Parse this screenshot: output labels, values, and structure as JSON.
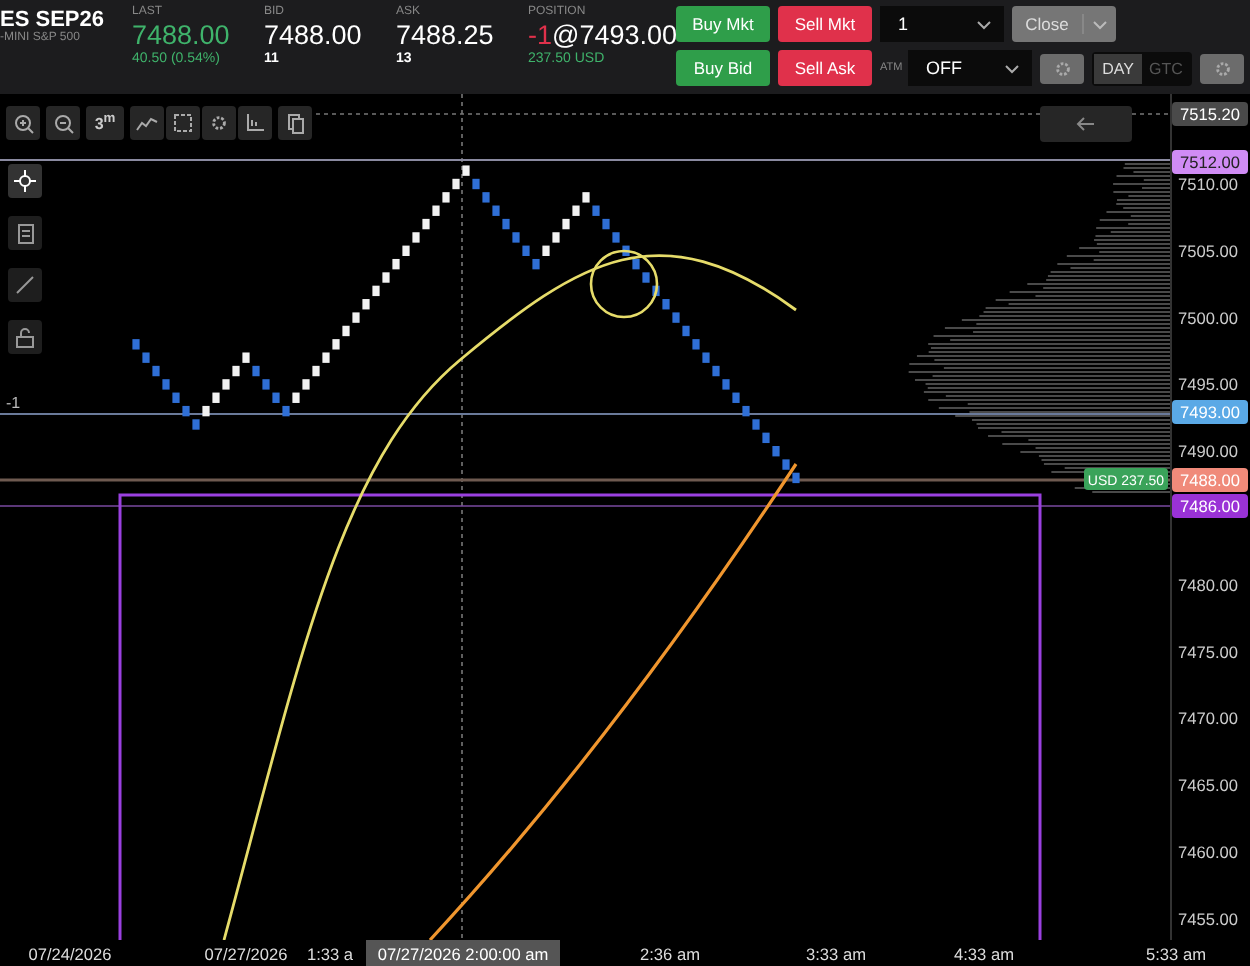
{
  "instrument": {
    "symbol": "ES SEP26",
    "name": "-MINI S&P 500"
  },
  "quotes": [
    {
      "label": "LAST",
      "value": "7488.00",
      "sub": "40.50 (0.54%)",
      "kind": "last"
    },
    {
      "label": "BID",
      "value": "7488.00",
      "sub": "11",
      "kind": "plain"
    },
    {
      "label": "ASK",
      "value": "7488.25",
      "sub": "13",
      "kind": "plain"
    }
  ],
  "position": {
    "label": "POSITION",
    "qty": "-1",
    "price": "@7493.00",
    "pnl": "237.50 USD"
  },
  "order_rows": [
    [
      {
        "kind": "buy",
        "label": "Buy Mkt"
      },
      {
        "kind": "sell",
        "label": "Sell Mkt"
      },
      {
        "kind": "select",
        "value": "1"
      },
      {
        "kind": "split",
        "label": "Close",
        "disabled": true
      }
    ],
    [
      {
        "kind": "buy",
        "label": "Buy Bid"
      },
      {
        "kind": "sell",
        "label": "Sell Ask"
      },
      {
        "kind": "label",
        "label": "ATM"
      },
      {
        "kind": "select",
        "value": "OFF"
      },
      {
        "kind": "gear"
      },
      {
        "kind": "toggle",
        "options": [
          {
            "label": "DAY",
            "selected": true
          },
          {
            "label": "GTC",
            "selected": false
          }
        ]
      },
      {
        "kind": "gear"
      }
    ]
  ],
  "toolbar": {
    "interval": "3$^{m}$"
  },
  "drawing_tools": [
    {
      "selected": true
    },
    {
      "selected": false
    },
    {
      "selected": false
    },
    {
      "selected": false
    }
  ],
  "chart": {
    "position_marker": "-1",
    "pnl_tag": "USD 237.50",
    "price_labels": [
      {
        "text": "7515.20",
        "kind": "crosshair"
      },
      {
        "text": "7512.00",
        "kind": "alert"
      },
      {
        "text": "7493.00",
        "kind": "entry"
      },
      {
        "text": "7488.00",
        "kind": "last"
      },
      {
        "text": "7486.00",
        "kind": "order"
      }
    ],
    "time_labels": [
      "07/24/2026",
      "07/27/2026",
      "1:33 a",
      "2:36 am",
      "3:33 am",
      "4:33 am",
      "5:33 am"
    ],
    "crosshair_time": "07/27/2026 2:00:00 am",
    "price_axis": [
      "7510.00",
      "7505.00",
      "7500.00",
      "7495.00",
      "7490.00",
      "7480.00",
      "7475.00",
      "7470.00",
      "7465.00",
      "7460.00",
      "7455.00"
    ]
  }
}
